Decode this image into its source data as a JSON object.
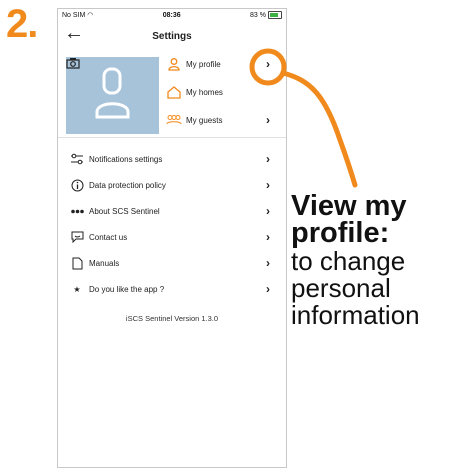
{
  "step_label": "2.",
  "status_bar": {
    "carrier": "No SIM",
    "time": "08:36",
    "battery": "83 %"
  },
  "header": {
    "title": "Settings"
  },
  "profile_menu": [
    {
      "label": "My profile",
      "icon": "person-icon"
    },
    {
      "label": "My homes",
      "icon": "home-icon"
    },
    {
      "label": "My guests",
      "icon": "guests-icon"
    }
  ],
  "menu": [
    {
      "label": "Notifications settings",
      "icon": "sliders-icon"
    },
    {
      "label": "Data protection policy",
      "icon": "info-icon"
    },
    {
      "label": "About SCS Sentinel",
      "icon": "dots-icon"
    },
    {
      "label": "Contact us",
      "icon": "chat-icon"
    },
    {
      "label": "Manuals",
      "icon": "document-icon"
    },
    {
      "label": "Do you like the app ?",
      "icon": "star-icon"
    }
  ],
  "version": "iSCS Sentinel Version 1.3.0",
  "annotation": {
    "heading_line1": "View my",
    "heading_line2": "profile:",
    "body_line1": "to change",
    "body_line2": "personal",
    "body_line3": "information"
  },
  "colors": {
    "accent": "#f08a1c",
    "avatar_bg": "#a7c3da"
  }
}
